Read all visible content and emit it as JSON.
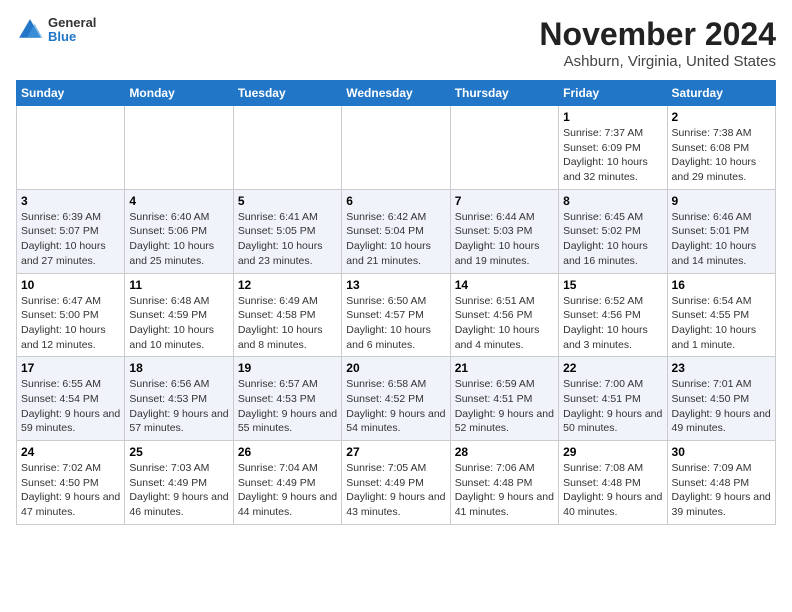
{
  "header": {
    "logo_general": "General",
    "logo_blue": "Blue",
    "title": "November 2024",
    "subtitle": "Ashburn, Virginia, United States"
  },
  "calendar": {
    "days_of_week": [
      "Sunday",
      "Monday",
      "Tuesday",
      "Wednesday",
      "Thursday",
      "Friday",
      "Saturday"
    ],
    "weeks": [
      [
        {
          "day": "",
          "info": ""
        },
        {
          "day": "",
          "info": ""
        },
        {
          "day": "",
          "info": ""
        },
        {
          "day": "",
          "info": ""
        },
        {
          "day": "",
          "info": ""
        },
        {
          "day": "1",
          "info": "Sunrise: 7:37 AM\nSunset: 6:09 PM\nDaylight: 10 hours and 32 minutes."
        },
        {
          "day": "2",
          "info": "Sunrise: 7:38 AM\nSunset: 6:08 PM\nDaylight: 10 hours and 29 minutes."
        }
      ],
      [
        {
          "day": "3",
          "info": "Sunrise: 6:39 AM\nSunset: 5:07 PM\nDaylight: 10 hours and 27 minutes."
        },
        {
          "day": "4",
          "info": "Sunrise: 6:40 AM\nSunset: 5:06 PM\nDaylight: 10 hours and 25 minutes."
        },
        {
          "day": "5",
          "info": "Sunrise: 6:41 AM\nSunset: 5:05 PM\nDaylight: 10 hours and 23 minutes."
        },
        {
          "day": "6",
          "info": "Sunrise: 6:42 AM\nSunset: 5:04 PM\nDaylight: 10 hours and 21 minutes."
        },
        {
          "day": "7",
          "info": "Sunrise: 6:44 AM\nSunset: 5:03 PM\nDaylight: 10 hours and 19 minutes."
        },
        {
          "day": "8",
          "info": "Sunrise: 6:45 AM\nSunset: 5:02 PM\nDaylight: 10 hours and 16 minutes."
        },
        {
          "day": "9",
          "info": "Sunrise: 6:46 AM\nSunset: 5:01 PM\nDaylight: 10 hours and 14 minutes."
        }
      ],
      [
        {
          "day": "10",
          "info": "Sunrise: 6:47 AM\nSunset: 5:00 PM\nDaylight: 10 hours and 12 minutes."
        },
        {
          "day": "11",
          "info": "Sunrise: 6:48 AM\nSunset: 4:59 PM\nDaylight: 10 hours and 10 minutes."
        },
        {
          "day": "12",
          "info": "Sunrise: 6:49 AM\nSunset: 4:58 PM\nDaylight: 10 hours and 8 minutes."
        },
        {
          "day": "13",
          "info": "Sunrise: 6:50 AM\nSunset: 4:57 PM\nDaylight: 10 hours and 6 minutes."
        },
        {
          "day": "14",
          "info": "Sunrise: 6:51 AM\nSunset: 4:56 PM\nDaylight: 10 hours and 4 minutes."
        },
        {
          "day": "15",
          "info": "Sunrise: 6:52 AM\nSunset: 4:56 PM\nDaylight: 10 hours and 3 minutes."
        },
        {
          "day": "16",
          "info": "Sunrise: 6:54 AM\nSunset: 4:55 PM\nDaylight: 10 hours and 1 minute."
        }
      ],
      [
        {
          "day": "17",
          "info": "Sunrise: 6:55 AM\nSunset: 4:54 PM\nDaylight: 9 hours and 59 minutes."
        },
        {
          "day": "18",
          "info": "Sunrise: 6:56 AM\nSunset: 4:53 PM\nDaylight: 9 hours and 57 minutes."
        },
        {
          "day": "19",
          "info": "Sunrise: 6:57 AM\nSunset: 4:53 PM\nDaylight: 9 hours and 55 minutes."
        },
        {
          "day": "20",
          "info": "Sunrise: 6:58 AM\nSunset: 4:52 PM\nDaylight: 9 hours and 54 minutes."
        },
        {
          "day": "21",
          "info": "Sunrise: 6:59 AM\nSunset: 4:51 PM\nDaylight: 9 hours and 52 minutes."
        },
        {
          "day": "22",
          "info": "Sunrise: 7:00 AM\nSunset: 4:51 PM\nDaylight: 9 hours and 50 minutes."
        },
        {
          "day": "23",
          "info": "Sunrise: 7:01 AM\nSunset: 4:50 PM\nDaylight: 9 hours and 49 minutes."
        }
      ],
      [
        {
          "day": "24",
          "info": "Sunrise: 7:02 AM\nSunset: 4:50 PM\nDaylight: 9 hours and 47 minutes."
        },
        {
          "day": "25",
          "info": "Sunrise: 7:03 AM\nSunset: 4:49 PM\nDaylight: 9 hours and 46 minutes."
        },
        {
          "day": "26",
          "info": "Sunrise: 7:04 AM\nSunset: 4:49 PM\nDaylight: 9 hours and 44 minutes."
        },
        {
          "day": "27",
          "info": "Sunrise: 7:05 AM\nSunset: 4:49 PM\nDaylight: 9 hours and 43 minutes."
        },
        {
          "day": "28",
          "info": "Sunrise: 7:06 AM\nSunset: 4:48 PM\nDaylight: 9 hours and 41 minutes."
        },
        {
          "day": "29",
          "info": "Sunrise: 7:08 AM\nSunset: 4:48 PM\nDaylight: 9 hours and 40 minutes."
        },
        {
          "day": "30",
          "info": "Sunrise: 7:09 AM\nSunset: 4:48 PM\nDaylight: 9 hours and 39 minutes."
        }
      ]
    ]
  }
}
